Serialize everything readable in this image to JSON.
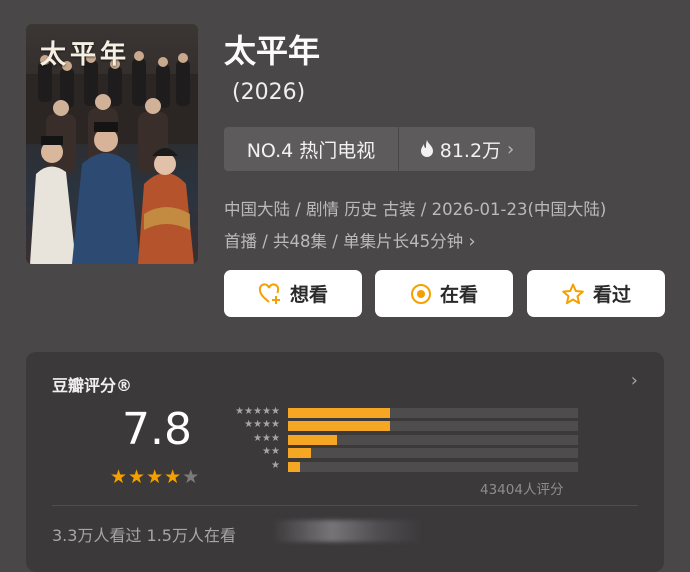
{
  "poster": {
    "title_text": "太平年"
  },
  "show": {
    "title": "太平年",
    "year": "(2026)"
  },
  "rank": {
    "label": "NO.4 热门电视",
    "heat": "81.2万",
    "icon": "fire-icon"
  },
  "meta": {
    "line1": "中国大陆 / 剧情 历史 古装 / 2026-01-23(中国大陆)",
    "line2": "首播 / 共48集 / 单集片长45分钟"
  },
  "actions": {
    "want": "想看",
    "watching": "在看",
    "watched": "看过"
  },
  "rating": {
    "title": "豆瓣评分®",
    "score": "7.8",
    "stars_filled": 4,
    "stars_total": 5,
    "votes": "43404人评分",
    "distribution": [
      {
        "stars": "★★★★★",
        "fraction": 0.35
      },
      {
        "stars": "★★★★",
        "fraction": 0.35
      },
      {
        "stars": "★★★",
        "fraction": 0.17
      },
      {
        "stars": "★★",
        "fraction": 0.08
      },
      {
        "stars": "★",
        "fraction": 0.04
      }
    ]
  },
  "footer": {
    "text": "3.3万人看过   1.5万人在看"
  },
  "colors": {
    "background": "#4a4748",
    "card": "#3b393a",
    "accent": "#f5a623",
    "star": "#f5a000"
  }
}
